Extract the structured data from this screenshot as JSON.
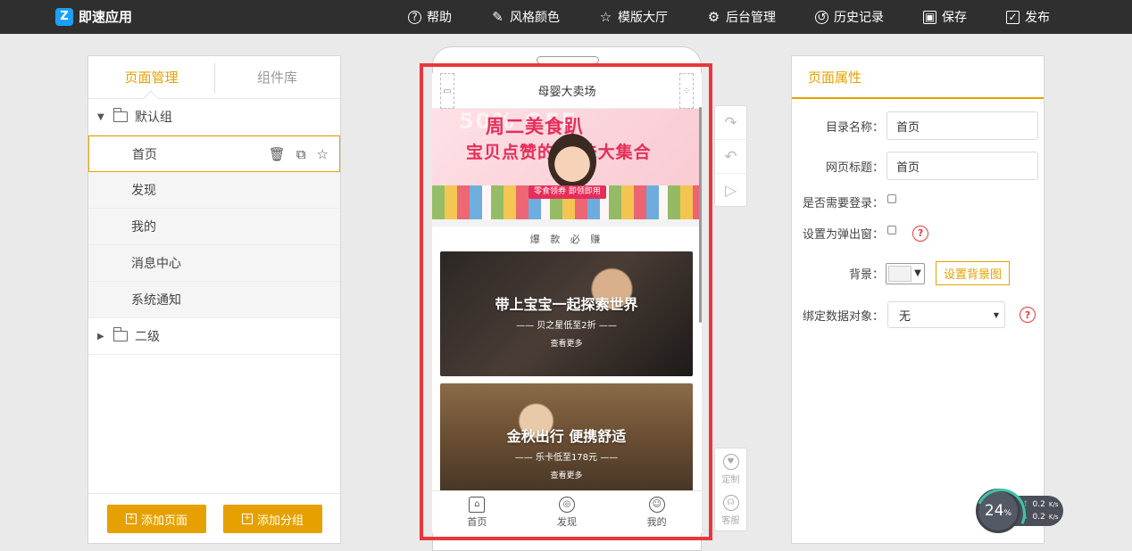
{
  "app": {
    "title": "即速应用",
    "logo_mark": "Z"
  },
  "nav": [
    {
      "label": "帮助",
      "icon": "?"
    },
    {
      "label": "风格颜色",
      "icon": "✎"
    },
    {
      "label": "模版大厅",
      "icon": "☆"
    },
    {
      "label": "后台管理",
      "icon": "⚙"
    },
    {
      "label": "历史记录",
      "icon": "↺"
    },
    {
      "label": "保存",
      "icon": "▣"
    },
    {
      "label": "发布",
      "icon": "✓"
    }
  ],
  "left": {
    "tabs": [
      "页面管理",
      "组件库"
    ],
    "groups": [
      {
        "name": "默认组",
        "pages": [
          "首页",
          "发现",
          "我的",
          "消息中心",
          "系统通知"
        ]
      },
      {
        "name": "二级"
      }
    ],
    "row_tools": {
      "delete": "🗑",
      "copy": "⧉",
      "star": "☆"
    },
    "add_page": "添加页面",
    "add_group": "添加分组"
  },
  "phone": {
    "header_title": "母婴大卖场",
    "banner": {
      "ghost": "50% OFF",
      "title1": "周二美食趴",
      "title2": "宝贝点赞的  美味大集合",
      "tag": "零食领券 即领即用"
    },
    "section_title": "爆 款 必 赚",
    "promos": [
      {
        "title": "带上宝宝一起探索世界",
        "sub": "—— 贝之星低至2折 ——",
        "more": "查看更多"
      },
      {
        "title": "金秋出行 便携舒适",
        "sub": "—— 乐卡低至178元 ——",
        "more": "查看更多"
      }
    ],
    "tabbar": [
      {
        "label": "首页",
        "icon": "⌂"
      },
      {
        "label": "发现",
        "icon": "◎"
      },
      {
        "label": "我的",
        "icon": "☺"
      }
    ]
  },
  "side_tools": {
    "redo": "↷",
    "undo": "↶",
    "preview": "▷",
    "custom": "定制",
    "service": "客服",
    "custom_icon": "♥",
    "service_icon": "☊"
  },
  "right": {
    "title": "页面属性",
    "dir_name_label": "目录名称：",
    "dir_name_value": "首页",
    "page_title_label": "网页标题：",
    "page_title_value": "首页",
    "need_login_label": "是否需要登录：",
    "popup_label": "设置为弹出窗：",
    "bg_label": "背景：",
    "bg_button": "设置背景图",
    "bind_label": "绑定数据对象：",
    "bind_value": "无",
    "help": "?"
  },
  "speed": {
    "percent": "24",
    "unit": "%",
    "up": "0.2",
    "down": "0.2",
    "rate_unit": "K/s"
  }
}
